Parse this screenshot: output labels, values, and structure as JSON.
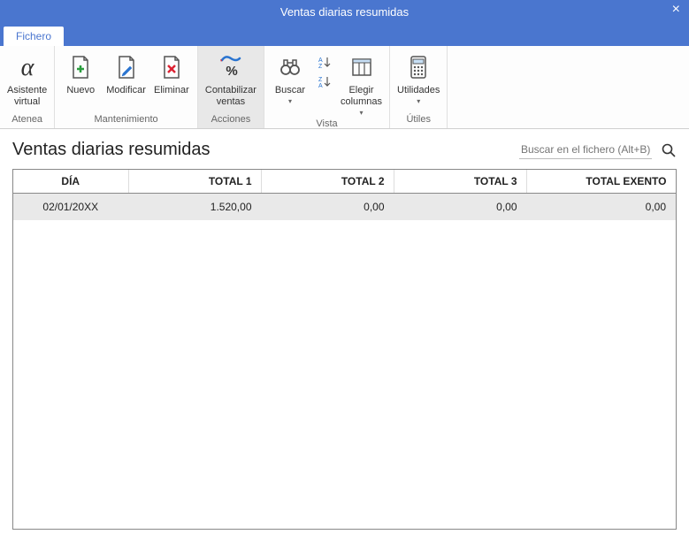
{
  "window": {
    "title": "Ventas diarias resumidas",
    "close": "×"
  },
  "tabs": {
    "file": "Fichero"
  },
  "ribbon": {
    "atenea": {
      "label": "Atenea",
      "asistente": "Asistente\nvirtual"
    },
    "mantenimiento": {
      "label": "Mantenimiento",
      "nuevo": "Nuevo",
      "modificar": "Modificar",
      "eliminar": "Eliminar"
    },
    "acciones": {
      "label": "Acciones",
      "contabilizar": "Contabilizar\nventas"
    },
    "vista": {
      "label": "Vista",
      "buscar": "Buscar",
      "elegir": "Elegir\ncolumnas"
    },
    "utiles": {
      "label": "Útiles",
      "utilidades": "Utilidades"
    }
  },
  "page": {
    "title": "Ventas diarias resumidas",
    "search_placeholder": "Buscar en el fichero (Alt+B)"
  },
  "table": {
    "headers": {
      "dia": "DÍA",
      "total1": "TOTAL 1",
      "total2": "TOTAL 2",
      "total3": "TOTAL 3",
      "exento": "TOTAL EXENTO"
    },
    "rows": [
      {
        "dia": "02/01/20XX",
        "t1": "1.520,00",
        "t2": "0,00",
        "t3": "0,00",
        "exento": "0,00"
      }
    ]
  }
}
